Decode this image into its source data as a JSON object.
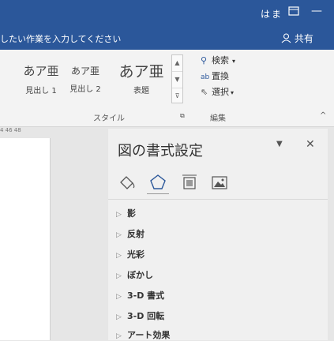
{
  "titlebar": {
    "user": "はま",
    "restore_icon": "ribbon-display-icon",
    "minimize": "—",
    "maximize": "□",
    "close": "✕"
  },
  "tellbar": {
    "hint": "したい作業を入力してください",
    "share": "共有"
  },
  "ribbon": {
    "styles": [
      {
        "sample": "あア亜",
        "name": "見出し 1"
      },
      {
        "sample": "あア亜",
        "name": "見出し 2"
      },
      {
        "sample": "あア亜",
        "name": "表題"
      }
    ],
    "styles_group": "スタイル",
    "editing": {
      "find": "検索",
      "replace": "置換",
      "select": "選択",
      "group": "編集"
    }
  },
  "ruler": {
    "ticks": "4   46   48"
  },
  "pane": {
    "title": "図の書式設定",
    "sections": [
      "影",
      "反射",
      "光彩",
      "ぼかし",
      "3-D 書式",
      "3-D 回転",
      "アート効果"
    ]
  }
}
